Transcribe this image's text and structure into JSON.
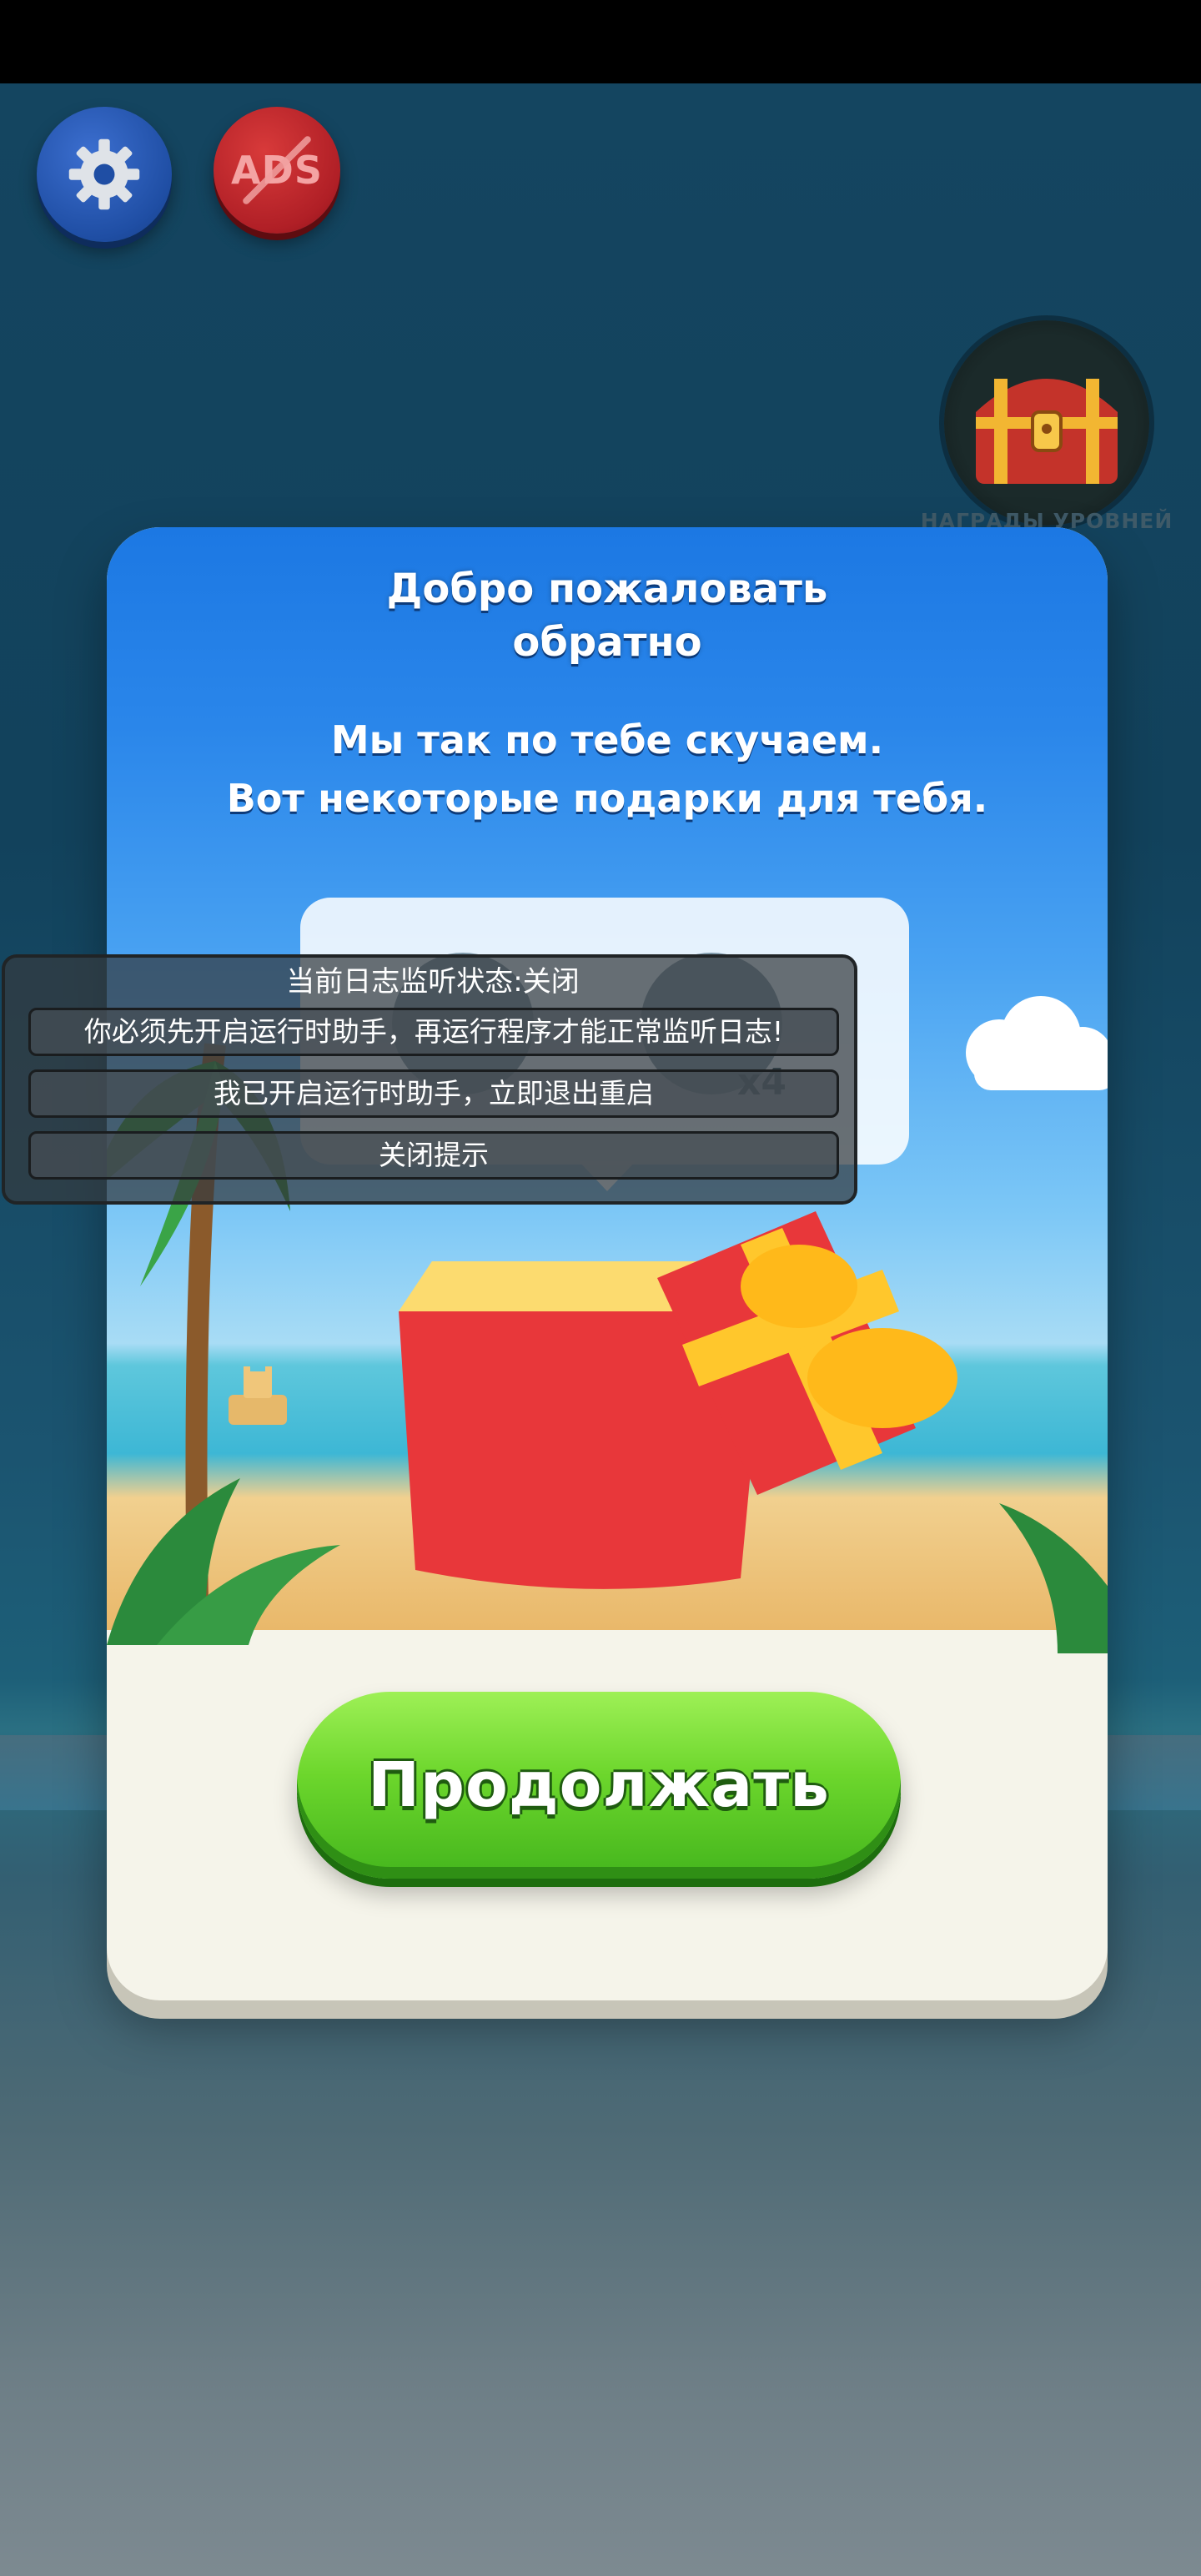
{
  "hud": {
    "ads_label": "ADS",
    "level_rewards_label": "НАГРАДЫ УРОВНЕЙ"
  },
  "modal": {
    "title_line1": "Добро пожаловать",
    "title_line2": "обратно",
    "subtitle_line1": "Мы так по тебе скучаем.",
    "subtitle_line2": "Вот некоторые подарки для тебя.",
    "gift_multiplier": "x4",
    "continue_label": "Продолжать"
  },
  "overlay": {
    "title": "当前日志监听状态:关闭",
    "message": "你必须先开启运行时助手，再运行程序才能正常监听日志!",
    "restart_button": "我已开启运行时助手，立即退出重启",
    "close_button": "关闭提示"
  },
  "colors": {
    "settings_button": "#1f4ea4",
    "ads_button": "#b01f26",
    "continue_button": "#6cd62c",
    "modal_sky": "#1c78e3"
  },
  "icons": [
    "gear-icon",
    "no-ads-icon",
    "treasure-chest-icon",
    "gift-box-icon"
  ]
}
